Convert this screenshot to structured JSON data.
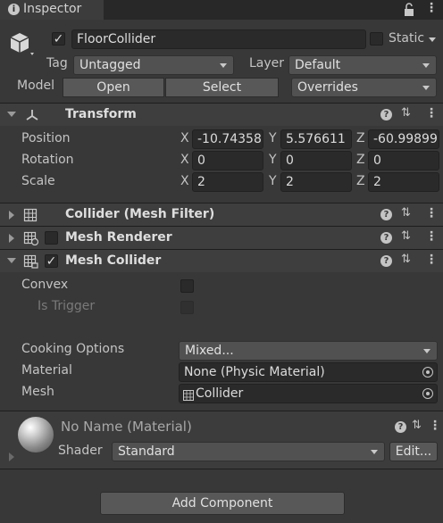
{
  "tab": {
    "title": "Inspector"
  },
  "object": {
    "name": "FloorCollider",
    "active": true,
    "static_label": "Static",
    "static_checked": false,
    "tag_label": "Tag",
    "tag_value": "Untagged",
    "layer_label": "Layer",
    "layer_value": "Default",
    "model_label": "Model",
    "open_label": "Open",
    "select_label": "Select",
    "overrides_label": "Overrides"
  },
  "transform": {
    "title": "Transform",
    "rows": [
      {
        "label": "Position",
        "x": "-10.74358",
        "y": "5.576611",
        "z": "-60.99899"
      },
      {
        "label": "Rotation",
        "x": "0",
        "y": "0",
        "z": "0"
      },
      {
        "label": "Scale",
        "x": "2",
        "y": "2",
        "z": "2"
      }
    ],
    "axes": {
      "x": "X",
      "y": "Y",
      "z": "Z"
    }
  },
  "collider_filter": {
    "title": "Collider (Mesh Filter)"
  },
  "mesh_renderer": {
    "title": "Mesh Renderer",
    "enabled": false
  },
  "mesh_collider": {
    "title": "Mesh Collider",
    "enabled": true,
    "convex_label": "Convex",
    "is_trigger_label": "Is Trigger",
    "cooking_label": "Cooking Options",
    "cooking_value": "Mixed...",
    "material_label": "Material",
    "material_value": "None (Physic Material)",
    "mesh_label": "Mesh",
    "mesh_value": "Collider"
  },
  "material": {
    "name": "No Name (Material)",
    "shader_label": "Shader",
    "shader_value": "Standard",
    "edit_label": "Edit..."
  },
  "add_component_label": "Add Component"
}
